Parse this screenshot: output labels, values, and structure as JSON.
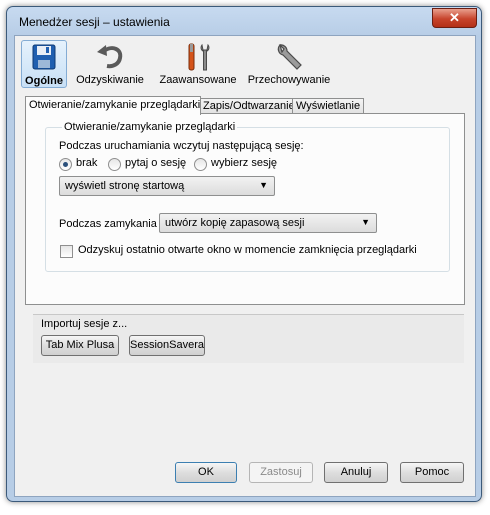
{
  "window": {
    "title": "Menedżer sesji – ustawienia",
    "close_symbol": "✕"
  },
  "toolbar": [
    {
      "label": "Ogólne",
      "icon": "floppy-disk-icon",
      "active": true
    },
    {
      "label": "Odzyskiwanie",
      "icon": "undo-arrow-icon"
    },
    {
      "label": "Zaawansowane",
      "icon": "tools-icon"
    },
    {
      "label": "Przechowywanie",
      "icon": "wrench-icon"
    }
  ],
  "tabs": [
    {
      "label": "Otwieranie/zamykanie przeglądarki",
      "active": true
    },
    {
      "label": "Zapis/Odtwarzanie"
    },
    {
      "label": "Wyświetlanie"
    }
  ],
  "group": {
    "legend": "Otwieranie/zamykanie przeglądarki",
    "startup_label": "Podczas uruchamiania wczytuj następującą sesję:",
    "radios": [
      {
        "label": "brak",
        "checked": true
      },
      {
        "label": "pytaj o sesję",
        "checked": false
      },
      {
        "label": "wybierz sesję",
        "checked": false
      }
    ],
    "startup_combo": "wyświetl stronę startową",
    "closing_label": "Podczas zamykania",
    "closing_combo": "utwórz kopię zapasową sesji",
    "checkbox_label": "Odzyskuj ostatnio otwarte okno w momencie zamknięcia przeglądarki",
    "checkbox_checked": false
  },
  "import": {
    "label": "Importuj sesje z...",
    "buttons": [
      "Tab Mix Plusa",
      "SessionSavera"
    ]
  },
  "dialog_buttons": {
    "ok": "OK",
    "apply": "Zastosuj",
    "cancel": "Anuluj",
    "help": "Pomoc"
  },
  "combo_arrow": "▼"
}
